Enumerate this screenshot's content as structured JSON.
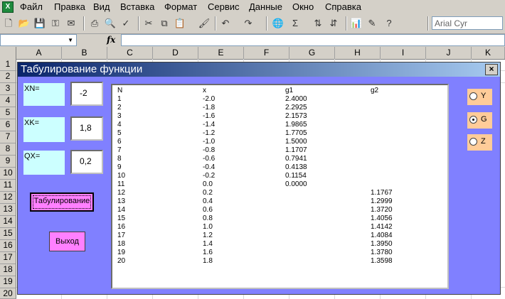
{
  "menu": [
    "Файл",
    "Правка",
    "Вид",
    "Вставка",
    "Формат",
    "Сервис",
    "Данные",
    "Окно",
    "Справка"
  ],
  "toolbar": {
    "font_name": "Arial Cyr",
    "fx_label": "fx"
  },
  "columns": [
    "A",
    "B",
    "C",
    "D",
    "E",
    "F",
    "G",
    "H",
    "I",
    "J",
    "K"
  ],
  "rows": [
    "1",
    "2",
    "3",
    "4",
    "5",
    "6",
    "7",
    "8",
    "9",
    "10",
    "11",
    "12",
    "13",
    "14",
    "15",
    "16",
    "17",
    "18",
    "19",
    "20"
  ],
  "dialog": {
    "title": "Табулирование функции",
    "close_glyph": "×",
    "xn_label": "XN=",
    "xn_value": "-2",
    "xk_label": "XK=",
    "xk_value": "1,8",
    "qx_label": "QX=",
    "qx_value": "0,2",
    "tab_button": "Табулирование",
    "exit_button": "Выход",
    "options": [
      {
        "label": "Y",
        "selected": false
      },
      {
        "label": "G",
        "selected": true
      },
      {
        "label": "Z",
        "selected": false
      }
    ],
    "list_header": [
      "N",
      "x",
      "g1",
      "g2"
    ],
    "list_rows": [
      [
        "1",
        "-2.0",
        "2.4000",
        ""
      ],
      [
        "2",
        "-1.8",
        "2.2925",
        ""
      ],
      [
        "3",
        "-1.6",
        "2.1573",
        ""
      ],
      [
        "4",
        "-1.4",
        "1.9865",
        ""
      ],
      [
        "5",
        "-1.2",
        "1.7705",
        ""
      ],
      [
        "6",
        "-1.0",
        "1.5000",
        ""
      ],
      [
        "7",
        "-0.8",
        "1.1707",
        ""
      ],
      [
        "8",
        "-0.6",
        "0.7941",
        ""
      ],
      [
        "9",
        "-0.4",
        "0.4138",
        ""
      ],
      [
        "10",
        "-0.2",
        "0.1154",
        ""
      ],
      [
        "11",
        "0.0",
        "0.0000",
        ""
      ],
      [
        "12",
        "0.2",
        "",
        "1.1767"
      ],
      [
        "13",
        "0.4",
        "",
        "1.2999"
      ],
      [
        "14",
        "0.6",
        "",
        "1.3720"
      ],
      [
        "15",
        "0.8",
        "",
        "1.4056"
      ],
      [
        "16",
        "1.0",
        "",
        "1.4142"
      ],
      [
        "17",
        "1.2",
        "",
        "1.4084"
      ],
      [
        "18",
        "1.4",
        "",
        "1.3950"
      ],
      [
        "19",
        "1.6",
        "",
        "1.3780"
      ],
      [
        "20",
        "1.8",
        "",
        "1.3598"
      ]
    ]
  }
}
